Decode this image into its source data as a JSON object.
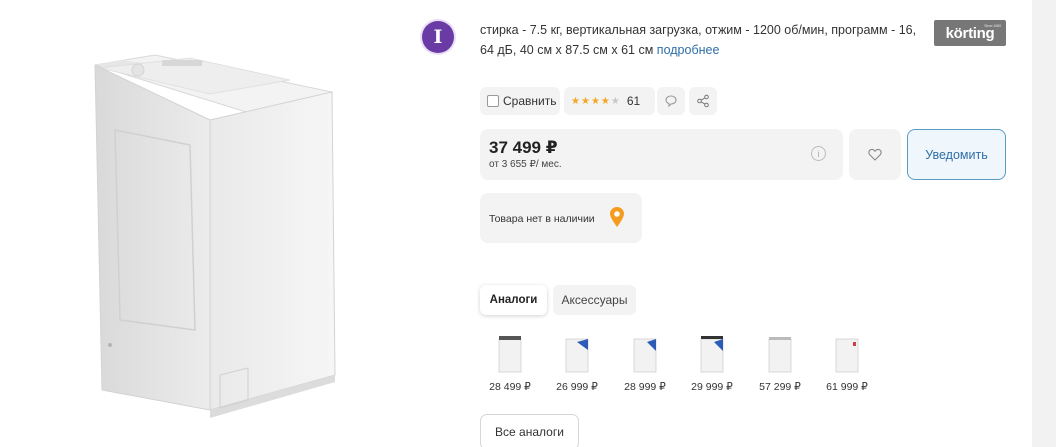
{
  "product": {
    "description": "стирка - 7.5 кг, вертикальная загрузка, отжим - 1200 об/мин, программ - 16, 64 дБ, 40 см x 87.5 см x 61 см",
    "more_link": "подробнее",
    "brand": "körting",
    "brand_small": "Since 1889",
    "avatar_letter": "I",
    "image_icon": "washing-machine"
  },
  "actions": {
    "compare_label": "Сравнить",
    "rating_stars": 4,
    "rating_max": 5,
    "reviews_count": "61",
    "comment_icon": "comment-icon",
    "share_icon": "share-icon"
  },
  "price": {
    "value": "37 499 ₽",
    "credit": "от 3 655 ₽/ мес.",
    "info_icon": "i",
    "favorite_icon": "heart-icon",
    "notify_label": "Уведомить"
  },
  "availability": {
    "text": "Товара нет в наличии",
    "pin_color": "#f59b1d"
  },
  "tabs": [
    {
      "label": "Аналоги",
      "active": true
    },
    {
      "label": "Аксессуары",
      "active": false
    }
  ],
  "analogs": [
    {
      "price": "28 499 ₽",
      "accent": "#555555"
    },
    {
      "price": "26 999 ₽",
      "accent": "#2b5cb8"
    },
    {
      "price": "28 999 ₽",
      "accent": "#2b5cb8"
    },
    {
      "price": "29 999 ₽",
      "accent": "#333333"
    },
    {
      "price": "57 299 ₽",
      "accent": "#bbbbbb"
    },
    {
      "price": "61 999 ₽",
      "accent": "#d04040"
    }
  ],
  "all_analogs_label": "Все аналоги",
  "colors": {
    "accent_link": "#2f6ea8",
    "star": "#f5a623",
    "avatar": "#6a3aa5"
  }
}
